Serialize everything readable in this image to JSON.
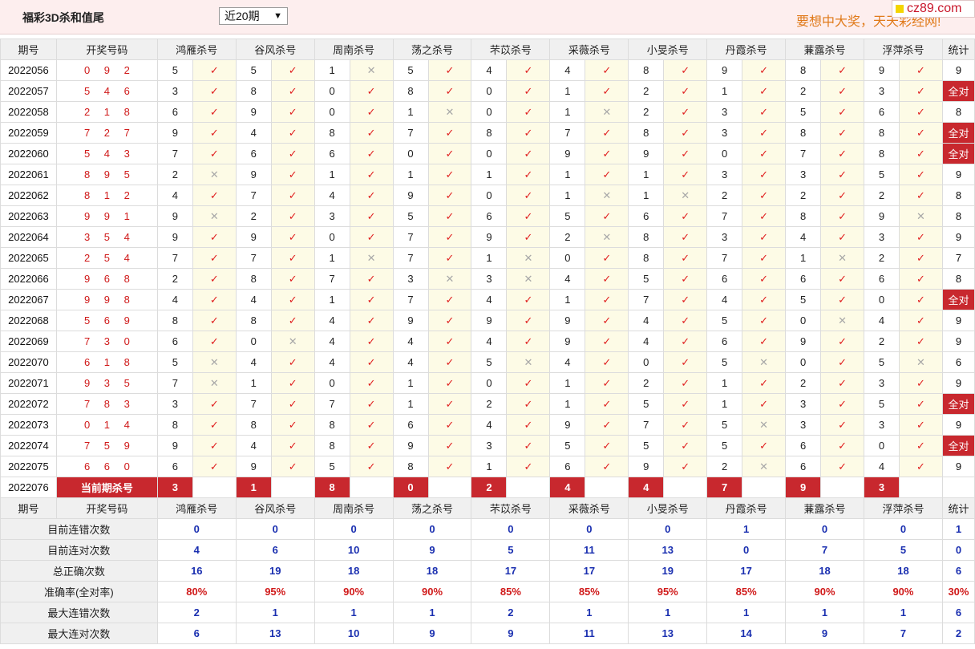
{
  "header": {
    "title": "福彩3D杀和值尾",
    "period_select": "近20期",
    "slogan": "要想中大奖，天天彩经网!",
    "site_badge": "cz89.com"
  },
  "table": {
    "col_period": "期号",
    "col_draw": "开奖号码",
    "experts": [
      "鸿雁杀号",
      "谷风杀号",
      "周南杀号",
      "荡之杀号",
      "芣苡杀号",
      "采薇杀号",
      "小旻杀号",
      "丹霞杀号",
      "蒹露杀号",
      "浮萍杀号"
    ],
    "col_stat": "统计",
    "rows": [
      {
        "period": "2022056",
        "draw": "0 9 2",
        "picks": [
          5,
          5,
          1,
          5,
          4,
          4,
          8,
          9,
          8,
          9
        ],
        "ok": [
          1,
          1,
          0,
          1,
          1,
          1,
          1,
          1,
          1,
          1
        ],
        "stat": "9"
      },
      {
        "period": "2022057",
        "draw": "5 4 6",
        "picks": [
          3,
          8,
          0,
          8,
          0,
          1,
          2,
          1,
          2,
          3
        ],
        "ok": [
          1,
          1,
          1,
          1,
          1,
          1,
          1,
          1,
          1,
          1
        ],
        "stat": "全对"
      },
      {
        "period": "2022058",
        "draw": "2 1 8",
        "picks": [
          6,
          9,
          0,
          1,
          0,
          1,
          2,
          3,
          5,
          6
        ],
        "ok": [
          1,
          1,
          1,
          0,
          1,
          0,
          1,
          1,
          1,
          1
        ],
        "stat": "8"
      },
      {
        "period": "2022059",
        "draw": "7 2 7",
        "picks": [
          9,
          4,
          8,
          7,
          8,
          7,
          8,
          3,
          8,
          8
        ],
        "ok": [
          1,
          1,
          1,
          1,
          1,
          1,
          1,
          1,
          1,
          1
        ],
        "stat": "全对"
      },
      {
        "period": "2022060",
        "draw": "5 4 3",
        "picks": [
          7,
          6,
          6,
          0,
          0,
          9,
          9,
          0,
          7,
          8
        ],
        "ok": [
          1,
          1,
          1,
          1,
          1,
          1,
          1,
          1,
          1,
          1
        ],
        "stat": "全对"
      },
      {
        "period": "2022061",
        "draw": "8 9 5",
        "picks": [
          2,
          9,
          1,
          1,
          1,
          1,
          1,
          3,
          3,
          5
        ],
        "ok": [
          0,
          1,
          1,
          1,
          1,
          1,
          1,
          1,
          1,
          1
        ],
        "stat": "9"
      },
      {
        "period": "2022062",
        "draw": "8 1 2",
        "picks": [
          4,
          7,
          4,
          9,
          0,
          1,
          1,
          2,
          2,
          2
        ],
        "ok": [
          1,
          1,
          1,
          1,
          1,
          0,
          0,
          1,
          1,
          1
        ],
        "stat": "8"
      },
      {
        "period": "2022063",
        "draw": "9 9 1",
        "picks": [
          9,
          2,
          3,
          5,
          6,
          5,
          6,
          7,
          8,
          9
        ],
        "ok": [
          0,
          1,
          1,
          1,
          1,
          1,
          1,
          1,
          1,
          0
        ],
        "stat": "8"
      },
      {
        "period": "2022064",
        "draw": "3 5 4",
        "picks": [
          9,
          9,
          0,
          7,
          9,
          2,
          8,
          3,
          4,
          3
        ],
        "ok": [
          1,
          1,
          1,
          1,
          1,
          0,
          1,
          1,
          1,
          1
        ],
        "stat": "9"
      },
      {
        "period": "2022065",
        "draw": "2 5 4",
        "picks": [
          7,
          7,
          1,
          7,
          1,
          0,
          8,
          7,
          1,
          2
        ],
        "ok": [
          1,
          1,
          0,
          1,
          0,
          1,
          1,
          1,
          0,
          1
        ],
        "stat": "7"
      },
      {
        "period": "2022066",
        "draw": "9 6 8",
        "picks": [
          2,
          8,
          7,
          3,
          3,
          4,
          5,
          6,
          6,
          6
        ],
        "ok": [
          1,
          1,
          1,
          0,
          0,
          1,
          1,
          1,
          1,
          1
        ],
        "stat": "8"
      },
      {
        "period": "2022067",
        "draw": "9 9 8",
        "picks": [
          4,
          4,
          1,
          7,
          4,
          1,
          7,
          4,
          5,
          0
        ],
        "ok": [
          1,
          1,
          1,
          1,
          1,
          1,
          1,
          1,
          1,
          1
        ],
        "stat": "全对"
      },
      {
        "period": "2022068",
        "draw": "5 6 9",
        "picks": [
          8,
          8,
          4,
          9,
          9,
          9,
          4,
          5,
          0,
          4
        ],
        "ok": [
          1,
          1,
          1,
          1,
          1,
          1,
          1,
          1,
          0,
          1
        ],
        "stat": "9"
      },
      {
        "period": "2022069",
        "draw": "7 3 0",
        "picks": [
          6,
          0,
          4,
          4,
          4,
          9,
          4,
          6,
          9,
          2
        ],
        "ok": [
          1,
          0,
          1,
          1,
          1,
          1,
          1,
          1,
          1,
          1
        ],
        "stat": "9"
      },
      {
        "period": "2022070",
        "draw": "6 1 8",
        "picks": [
          5,
          4,
          4,
          4,
          5,
          4,
          0,
          5,
          0,
          5
        ],
        "ok": [
          0,
          1,
          1,
          1,
          0,
          1,
          1,
          0,
          1,
          0
        ],
        "stat": "6"
      },
      {
        "period": "2022071",
        "draw": "9 3 5",
        "picks": [
          7,
          1,
          0,
          1,
          0,
          1,
          2,
          1,
          2,
          3
        ],
        "ok": [
          0,
          1,
          1,
          1,
          1,
          1,
          1,
          1,
          1,
          1
        ],
        "stat": "9"
      },
      {
        "period": "2022072",
        "draw": "7 8 3",
        "picks": [
          3,
          7,
          7,
          1,
          2,
          1,
          5,
          1,
          3,
          5
        ],
        "ok": [
          1,
          1,
          1,
          1,
          1,
          1,
          1,
          1,
          1,
          1
        ],
        "stat": "全对"
      },
      {
        "period": "2022073",
        "draw": "0 1 4",
        "picks": [
          8,
          8,
          8,
          6,
          4,
          9,
          7,
          5,
          3,
          3
        ],
        "ok": [
          1,
          1,
          1,
          1,
          1,
          1,
          1,
          0,
          1,
          1
        ],
        "stat": "9"
      },
      {
        "period": "2022074",
        "draw": "7 5 9",
        "picks": [
          9,
          4,
          8,
          9,
          3,
          5,
          5,
          5,
          6,
          0
        ],
        "ok": [
          1,
          1,
          1,
          1,
          1,
          1,
          1,
          1,
          1,
          1
        ],
        "stat": "全对"
      },
      {
        "period": "2022075",
        "draw": "6 6 0",
        "picks": [
          6,
          9,
          5,
          8,
          1,
          6,
          9,
          2,
          6,
          4
        ],
        "ok": [
          1,
          1,
          1,
          1,
          1,
          1,
          1,
          0,
          1,
          1
        ],
        "stat": "9"
      }
    ],
    "current": {
      "period": "2022076",
      "label": "当前期杀号",
      "picks": [
        "3",
        "1",
        "8",
        "0",
        "2",
        "4",
        "4",
        "7",
        "9",
        "3"
      ]
    },
    "summary": [
      {
        "label": "目前连错次数",
        "values": [
          "0",
          "0",
          "0",
          "0",
          "0",
          "0",
          "0",
          "1",
          "0",
          "0"
        ],
        "stat": "1",
        "style": "blue"
      },
      {
        "label": "目前连对次数",
        "values": [
          "4",
          "6",
          "10",
          "9",
          "5",
          "11",
          "13",
          "0",
          "7",
          "5"
        ],
        "stat": "0",
        "style": "blue"
      },
      {
        "label": "总正确次数",
        "values": [
          "16",
          "19",
          "18",
          "18",
          "17",
          "17",
          "19",
          "17",
          "18",
          "18"
        ],
        "stat": "6",
        "style": "blue"
      },
      {
        "label": "准确率(全对率)",
        "values": [
          "80%",
          "95%",
          "90%",
          "90%",
          "85%",
          "85%",
          "95%",
          "85%",
          "90%",
          "90%"
        ],
        "stat": "30%",
        "style": "red"
      },
      {
        "label": "最大连错次数",
        "values": [
          "2",
          "1",
          "1",
          "1",
          "2",
          "1",
          "1",
          "1",
          "1",
          "1"
        ],
        "stat": "6",
        "style": "blue"
      },
      {
        "label": "最大连对次数",
        "values": [
          "6",
          "13",
          "10",
          "9",
          "9",
          "11",
          "13",
          "14",
          "9",
          "7"
        ],
        "stat": "2",
        "style": "blue"
      }
    ],
    "colors": {
      "accent": "#c8282e",
      "tick": "#e02020",
      "cross": "#a8a8a8",
      "mark_bg": "#fdfbe6",
      "header_bg": "#f0f0f0"
    },
    "icons": {
      "ok": "check-icon",
      "miss": "cross-icon"
    }
  }
}
